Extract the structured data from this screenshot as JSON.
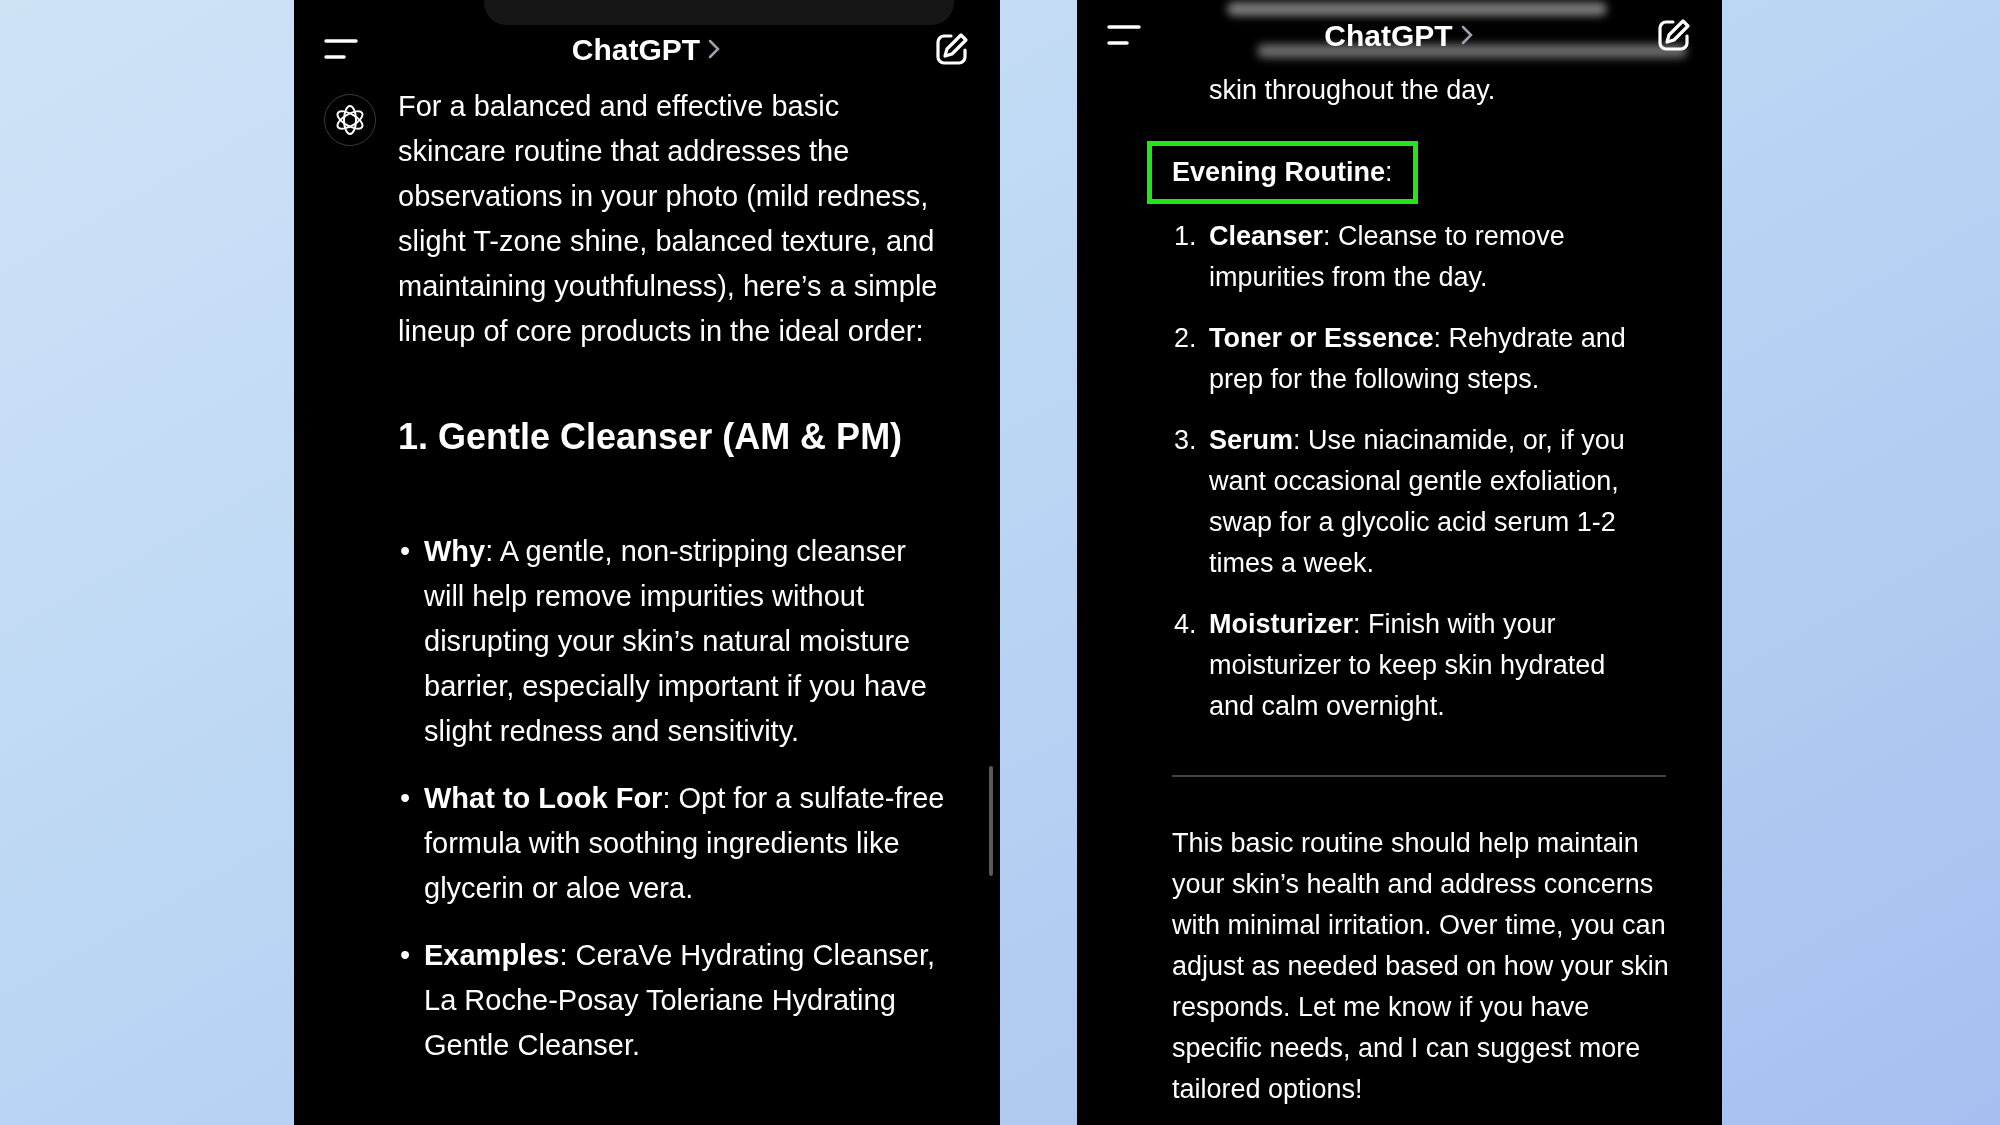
{
  "left_screen": {
    "header": {
      "title": "ChatGPT"
    },
    "intro": "For a balanced and effective basic skincare routine that addresses the observations in your photo (mild redness, slight T-zone shine, balanced texture, and maintaining youthfulness), here’s a simple lineup of core products in the ideal order:",
    "heading": "1. Gentle Cleanser (AM & PM)",
    "bullets": [
      "•",
      "•",
      "•"
    ],
    "items": [
      "**Why**: A gentle, non-stripping cleanser will help remove impurities without disrupting your skin’s natural moisture barrier, especially important if you have slight redness and sensitivity.",
      "**What to Look For**: Opt for a sulfate-free formula with soothing ingredients like glycerin or aloe vera.",
      "**Examples**: CeraVe Hydrating Cleanser, La Roche-Posay Toleriane Hydrating Gentle Cleanser."
    ]
  },
  "right_screen": {
    "header": {
      "title": "ChatGPT"
    },
    "partial_line": "skin throughout the day.",
    "section_title": {
      "text": "**Evening Routine**:",
      "highlighted": true
    },
    "steps": [
      {
        "number": "1.",
        "text": "**Cleanser**: Cleanse to remove impurities from the day."
      },
      {
        "number": "2.",
        "text": "**Toner or Essence**: Rehydrate and prep for the following steps."
      },
      {
        "number": "3.",
        "text": "**Serum**: Use niacinamide, or, if you want occasional gentle exfoliation, swap for a glycolic acid serum 1-2 times a week."
      },
      {
        "number": "4.",
        "text": "**Moisturizer**: Finish with your moisturizer to keep skin hydrated and calm overnight."
      }
    ],
    "closing": "This basic routine should help maintain your skin’s health and address concerns with minimal irritation. Over time, you can adjust as needed based on how your skin responds. Let me know if you have specific needs, and I can suggest more tailored options!"
  }
}
